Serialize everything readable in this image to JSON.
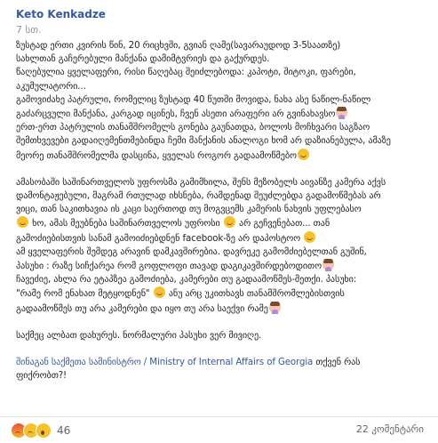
{
  "post": {
    "author": "Keto Kenkadze",
    "time": "7 სთ.",
    "p1": [
      "ზუსტად ერთი კვირის წინ, 20 რიცხვში, გვიან ღამე(სავარაუდოდ 3-5საათზე)",
      "სახლთან გაჩერებული მანქანა დამიმტვრიეს და გაქურდეს.",
      "წაღებულია ყველაფერი, რისი წაღებაც შეიძლებოდა: კაპოტი, შიტოკი, ფარები,",
      "აკუმულატორი...",
      "გამოვიძახე პატრული, რომელიც ზუსტად 40 წუთში მოვიდა, ნახა ასე ნაწილ-ნაწილ",
      "გაძარცვული მანქანა, კარგად იცინეს, ჩვენ ასეთი არაფერი არ გვინახავსო",
      "ერთ-ერთ პატრულის თანამშრომელს გონება გაუნათდა, ბოლოს მოჩხვარი საგზაო",
      "შემთხვევები გადაიღემენთმებინდა ჩემი მანქანის ანალოგი ხომ არ დაზიანებულა, ამაზე",
      "მეორე თანამშრომელმა დასცინა, ყველას როგორ გადაამოწმებო"
    ],
    "p2": [
      "ამასობაში საშინართველოს უფროსმა გამიმხილა, შენს მეზობელს აივანზე კამერა აქვს",
      "დამონტაჟებული, მაგრამ რთულად იხსნება, რამდენად შეუძლებდა გადამოწმებას არ",
      "ვიცი, თან საკითხავია ის კაცი საერთოდ თუ მოგვცემს კამერის ნახვის უფლებასო",
      "ხო, ამას მეუბნება საშინართველოს უფროსი",
      "არ გეჩვენებათ... თან",
      "გამოძიებისთვის სანამ გამოიძიებდნენ facebook-ზე არ დაპოსტოო",
      "ამ ყველაფერის შემდეგ არავინ დამკავშირებია. დავრეკე გამომძიებელთან გუშინ,",
      "პასუხი : რაზე სიჩქარეა რომ გოფლოფი თავად დაგიკავშირდებოდითო",
      "ჩავეძიე, ახლა რა ეტაპზეა გამოძიება, კამერები თუ გადაამოწმეს-მეთქი. პასუხი:",
      "\"რამე რომ ენახათ მეტყოდნენ\"",
      "ანუ არც უკითხავს თანამშრომლებისთვის",
      "გადაამოწმეს თუ არა კამერები და იყო თუ არა საექვი რამე"
    ],
    "p3": "საქმეც ალბათ დახურეს. ნორმალური პასუხი ვერ მივიღე.",
    "p4_prefix": "შინაგან საქმეთა სამინისტრო / Ministry of Internal Affairs of Georgia",
    "p4_suffix": "თქვენ რას",
    "p4_line2": "ფიქრობთ?!"
  },
  "footer": {
    "reaction_count": "46",
    "comments": "22 კომენტარი"
  },
  "icons": [
    "smile-emoji",
    "woman-facepalm-emoji",
    "angry-react-icon",
    "sad-react-icon",
    "wow-react-icon"
  ]
}
